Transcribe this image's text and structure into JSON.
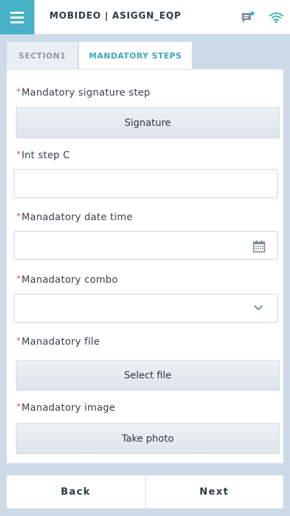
{
  "header": {
    "title": "MOBIDEO | ASIGGN_EQP",
    "menu_icon": "hamburger-icon",
    "message_icon": "chat-icon",
    "connection_icon": "wifi-icon",
    "accent_color": "#47b2c6"
  },
  "tabs": [
    {
      "label": "SECTION1",
      "active": false
    },
    {
      "label": "MANDATORY STEPS",
      "active": true
    }
  ],
  "fields": {
    "signature": {
      "label": "Mandatory signature step",
      "button": "Signature"
    },
    "int_step": {
      "label": "Int step C",
      "value": ""
    },
    "date_time": {
      "label": "Manadatory date time",
      "value": "",
      "icon": "calendar-icon"
    },
    "combo": {
      "label": "Manadatory combo",
      "value": "",
      "icon": "chevron-down-icon"
    },
    "file": {
      "label": "Manadatory file",
      "button": "Select file"
    },
    "image": {
      "label": "Manadatory image",
      "button": "Take photo"
    }
  },
  "required_marker": "*",
  "footer": {
    "back_label": "Back",
    "next_label": "Next"
  }
}
